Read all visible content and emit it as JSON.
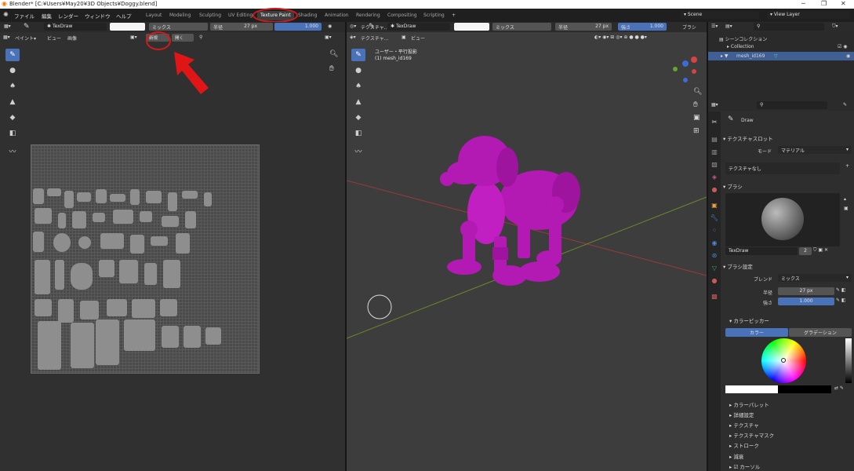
{
  "title": "Blender* [C:¥Users¥May20¥3D Objects¥Doggy.blend]",
  "menu": [
    "ファイル",
    "編集",
    "レンダー",
    "ウィンドウ",
    "ヘルプ"
  ],
  "workspaces": [
    "Layout",
    "Modeling",
    "Sculpting",
    "UV Editing",
    "Texture Paint",
    "Shading",
    "Animation",
    "Rendering",
    "Compositing",
    "Scripting"
  ],
  "active_workspace": "Texture Paint",
  "scene": "Scene",
  "view_layer": "View Layer",
  "left_header": {
    "brush": "TexDraw",
    "blend": "ミックス",
    "radius_label": "半径",
    "radius": "27 px",
    "strength": "1.000"
  },
  "left_menu": {
    "paint": "ペイント",
    "view": "ビュー",
    "image": "画像",
    "new": "新規",
    "open": "開く"
  },
  "vp_header": {
    "mode": "テクスチャ...",
    "view": "ビュー",
    "brush": "TexDraw",
    "blend": "ミックス",
    "radius_label": "半径",
    "radius": "27 px",
    "strength_label": "強さ",
    "strength": "1.000",
    "brush_menu": "ブラシ"
  },
  "viewport": {
    "projection": "ユーザー・平行投影",
    "object": "(1) mesh_id169"
  },
  "outliner": {
    "root": "シーンコレクション",
    "collection": "Collection",
    "object": "mesh_id169"
  },
  "props": {
    "tool_name": "Draw",
    "texture_slots": "テクスチャスロット",
    "mode_label": "モード",
    "mode_value": "マテリアル",
    "no_texture": "テクスチャなし",
    "brush_panel": "ブラシ",
    "brush_name": "TexDraw",
    "brush_users": "2",
    "brush_settings": "ブラシ設定",
    "blend_label": "ブレンド",
    "blend_value": "ミックス",
    "radius_label": "半径",
    "radius": "27 px",
    "strength_label": "強さ",
    "strength": "1.000",
    "color_picker": "カラーピッカー",
    "tab_color": "カラー",
    "tab_gradient": "グラデーション",
    "collapsed": [
      "カラーパレット",
      "詳細設定",
      "テクスチャ",
      "テクスチャマスク",
      "ストローク",
      "減衰",
      "カーソル"
    ]
  },
  "colors": {
    "accent": "#4a72b8",
    "dog": "#b319b3",
    "annotation": "#d21a1a"
  },
  "icons": [
    "blender-logo-icon",
    "brush-icon",
    "drop-icon",
    "smear-icon",
    "clone-icon",
    "fill-icon",
    "mask-icon",
    "annotate-icon",
    "zoom-icon",
    "hand-icon",
    "camera-icon",
    "grid-icon",
    "eye-icon"
  ]
}
